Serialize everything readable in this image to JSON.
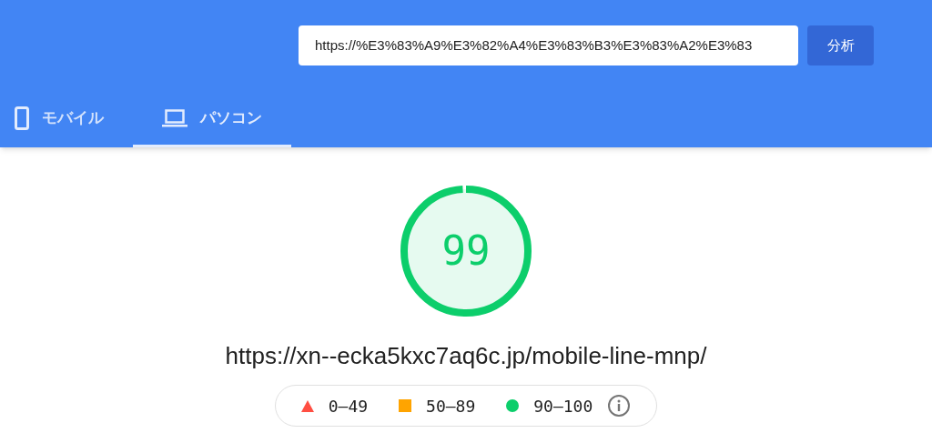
{
  "header": {
    "url_field": {
      "value": "https://%E3%83%A9%E3%82%A4%E3%83%B3%E3%83%A2%E3%83"
    },
    "analyze_button": "分析"
  },
  "tabs": [
    {
      "label": "モバイル",
      "kind": "phone",
      "selected": false
    },
    {
      "label": "パソコン",
      "kind": "laptop",
      "selected": true
    }
  ],
  "score": {
    "value": "99",
    "color": "#0cce6b"
  },
  "url": "https://xn--ecka5kxc7aq6c.jp/mobile-line-mnp/",
  "legend": [
    {
      "kind": "triangle",
      "label": "0–49",
      "color": "#ff4e42"
    },
    {
      "kind": "square",
      "label": "50–89",
      "color": "#ffa400"
    },
    {
      "kind": "circle",
      "label": "90–100",
      "color": "#0cce6b"
    }
  ]
}
